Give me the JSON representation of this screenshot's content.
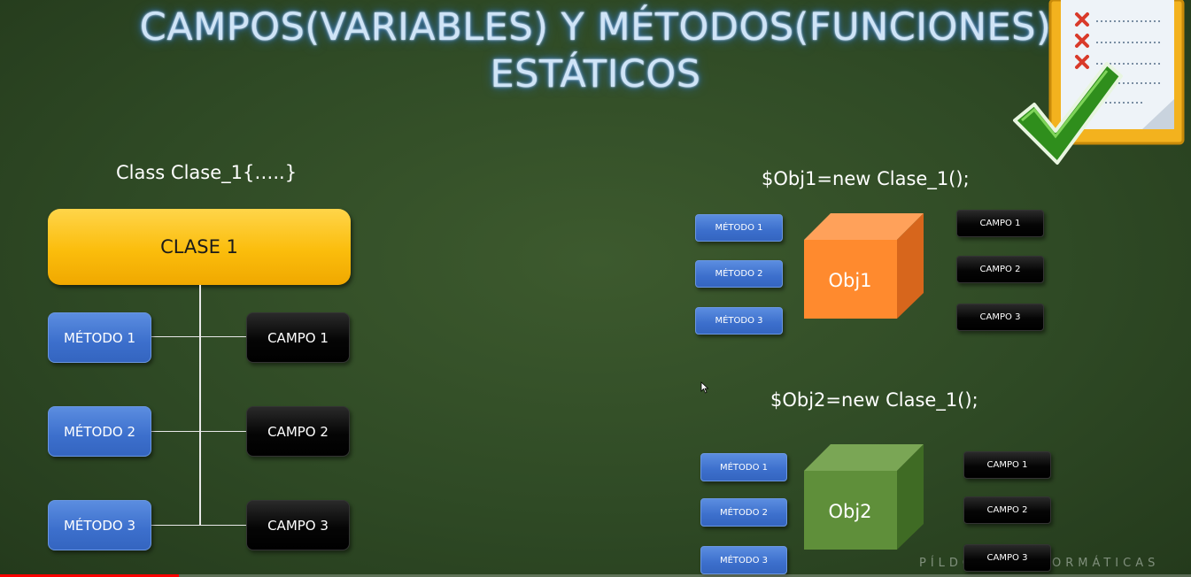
{
  "title": {
    "line1": "CAMPOS(VARIABLES) Y MÉTODOS(FUNCIONES)",
    "line2": "ESTÁTICOS"
  },
  "class_code": "Class Clase_1{…..}",
  "class_diagram": {
    "class_label": "CLASE 1",
    "methods": [
      "MÉTODO 1",
      "MÉTODO 2",
      "MÉTODO 3"
    ],
    "fields": [
      "CAMPO 1",
      "CAMPO 2",
      "CAMPO 3"
    ]
  },
  "obj1": {
    "code": "$Obj1=new Clase_1();",
    "label": "Obj1",
    "methods": [
      "MÉTODO 1",
      "MÉTODO 2",
      "MÉTODO 3"
    ],
    "fields": [
      "CAMPO 1",
      "CAMPO 2",
      "CAMPO 3"
    ],
    "color": "#ff8a2e"
  },
  "obj2": {
    "code": "$Obj2=new Clase_1();",
    "label": "Obj2",
    "methods": [
      "MÉTODO 1",
      "MÉTODO 2",
      "MÉTODO 3"
    ],
    "fields": [
      "CAMPO 1",
      "CAMPO 2",
      "CAMPO 3"
    ],
    "color": "#5f8f3a"
  },
  "watermark": "PÍLDORAS INFORMÁTICAS",
  "icons": {
    "checklist": "checklist-icon",
    "check": "checkmark-icon"
  },
  "video_progress": 0.15
}
